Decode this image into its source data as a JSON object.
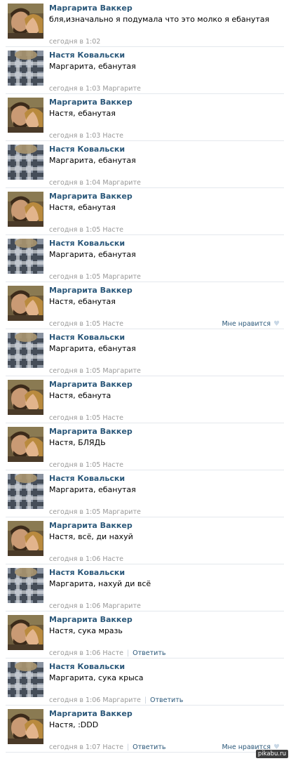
{
  "comments": [
    {
      "author": "Маргарита Ваккер",
      "avatar": "couple-photo",
      "text": "бля,изначально я подумала что это молко я ебанутая",
      "date": "сегодня в 1:02",
      "reply_to": "",
      "reply_label": "",
      "like_label": ""
    },
    {
      "author": "Настя Ковальски",
      "avatar": "plaid-photo",
      "text": "Маргарита, ебанутая",
      "date": "сегодня в 1:03",
      "reply_to": "Маргарите",
      "reply_label": "",
      "like_label": ""
    },
    {
      "author": "Маргарита Ваккер",
      "avatar": "couple-photo",
      "text": "Настя, ебанутая",
      "date": "сегодня в 1:03",
      "reply_to": "Насте",
      "reply_label": "",
      "like_label": ""
    },
    {
      "author": "Настя Ковальски",
      "avatar": "plaid-photo",
      "text": "Маргарита, ебанутая",
      "date": "сегодня в 1:04",
      "reply_to": "Маргарите",
      "reply_label": "",
      "like_label": ""
    },
    {
      "author": "Маргарита Ваккер",
      "avatar": "couple-photo",
      "text": "Настя, ебанутая",
      "date": "сегодня в 1:05",
      "reply_to": "Насте",
      "reply_label": "",
      "like_label": ""
    },
    {
      "author": "Настя Ковальски",
      "avatar": "plaid-photo",
      "text": "Маргарита, ебанутая",
      "date": "сегодня в 1:05",
      "reply_to": "Маргарите",
      "reply_label": "",
      "like_label": ""
    },
    {
      "author": "Маргарита Ваккер",
      "avatar": "couple-photo",
      "text": "Настя, ебанутая",
      "date": "сегодня в 1:05",
      "reply_to": "Насте",
      "reply_label": "",
      "like_label": "Мне нравится"
    },
    {
      "author": "Настя Ковальски",
      "avatar": "plaid-photo",
      "text": "Маргарита, ебанутая",
      "date": "сегодня в 1:05",
      "reply_to": "Маргарите",
      "reply_label": "",
      "like_label": ""
    },
    {
      "author": "Маргарита Ваккер",
      "avatar": "couple-photo",
      "text": "Настя, ебанута",
      "date": "сегодня в 1:05",
      "reply_to": "Насте",
      "reply_label": "",
      "like_label": ""
    },
    {
      "author": "Маргарита Ваккер",
      "avatar": "couple-photo",
      "text": "Настя, БЛЯДЬ",
      "date": "сегодня в 1:05",
      "reply_to": "Насте",
      "reply_label": "",
      "like_label": ""
    },
    {
      "author": "Настя Ковальски",
      "avatar": "plaid-photo",
      "text": "Маргарита, ебанутая",
      "date": "сегодня в 1:05",
      "reply_to": "Маргарите",
      "reply_label": "",
      "like_label": ""
    },
    {
      "author": "Маргарита Ваккер",
      "avatar": "couple-photo",
      "text": "Настя, всё, ди нахуй",
      "date": "сегодня в 1:06",
      "reply_to": "Насте",
      "reply_label": "",
      "like_label": ""
    },
    {
      "author": "Настя Ковальски",
      "avatar": "plaid-photo",
      "text": "Маргарита, нахуй ди всё",
      "date": "сегодня в 1:06",
      "reply_to": "Маргарите",
      "reply_label": "",
      "like_label": ""
    },
    {
      "author": "Маргарита Ваккер",
      "avatar": "couple-photo",
      "text": "Настя, сука мразь",
      "date": "сегодня в 1:06",
      "reply_to": "Насте",
      "reply_label": "Ответить",
      "like_label": ""
    },
    {
      "author": "Настя Ковальски",
      "avatar": "plaid-photo",
      "text": "Маргарита, сука крыса",
      "date": "сегодня в 1:06",
      "reply_to": "Маргарите",
      "reply_label": "Ответить",
      "like_label": ""
    },
    {
      "author": "Маргарита Ваккер",
      "avatar": "couple-photo",
      "text": "Настя, :DDD",
      "date": "сегодня в 1:07",
      "reply_to": "Насте",
      "reply_label": "Ответить",
      "like_label": "Мне нравится"
    }
  ],
  "watermark": "pikabu.ru",
  "colors": {
    "author": "#2b587a",
    "meta": "#999999",
    "separator": "#e4e8ed"
  }
}
